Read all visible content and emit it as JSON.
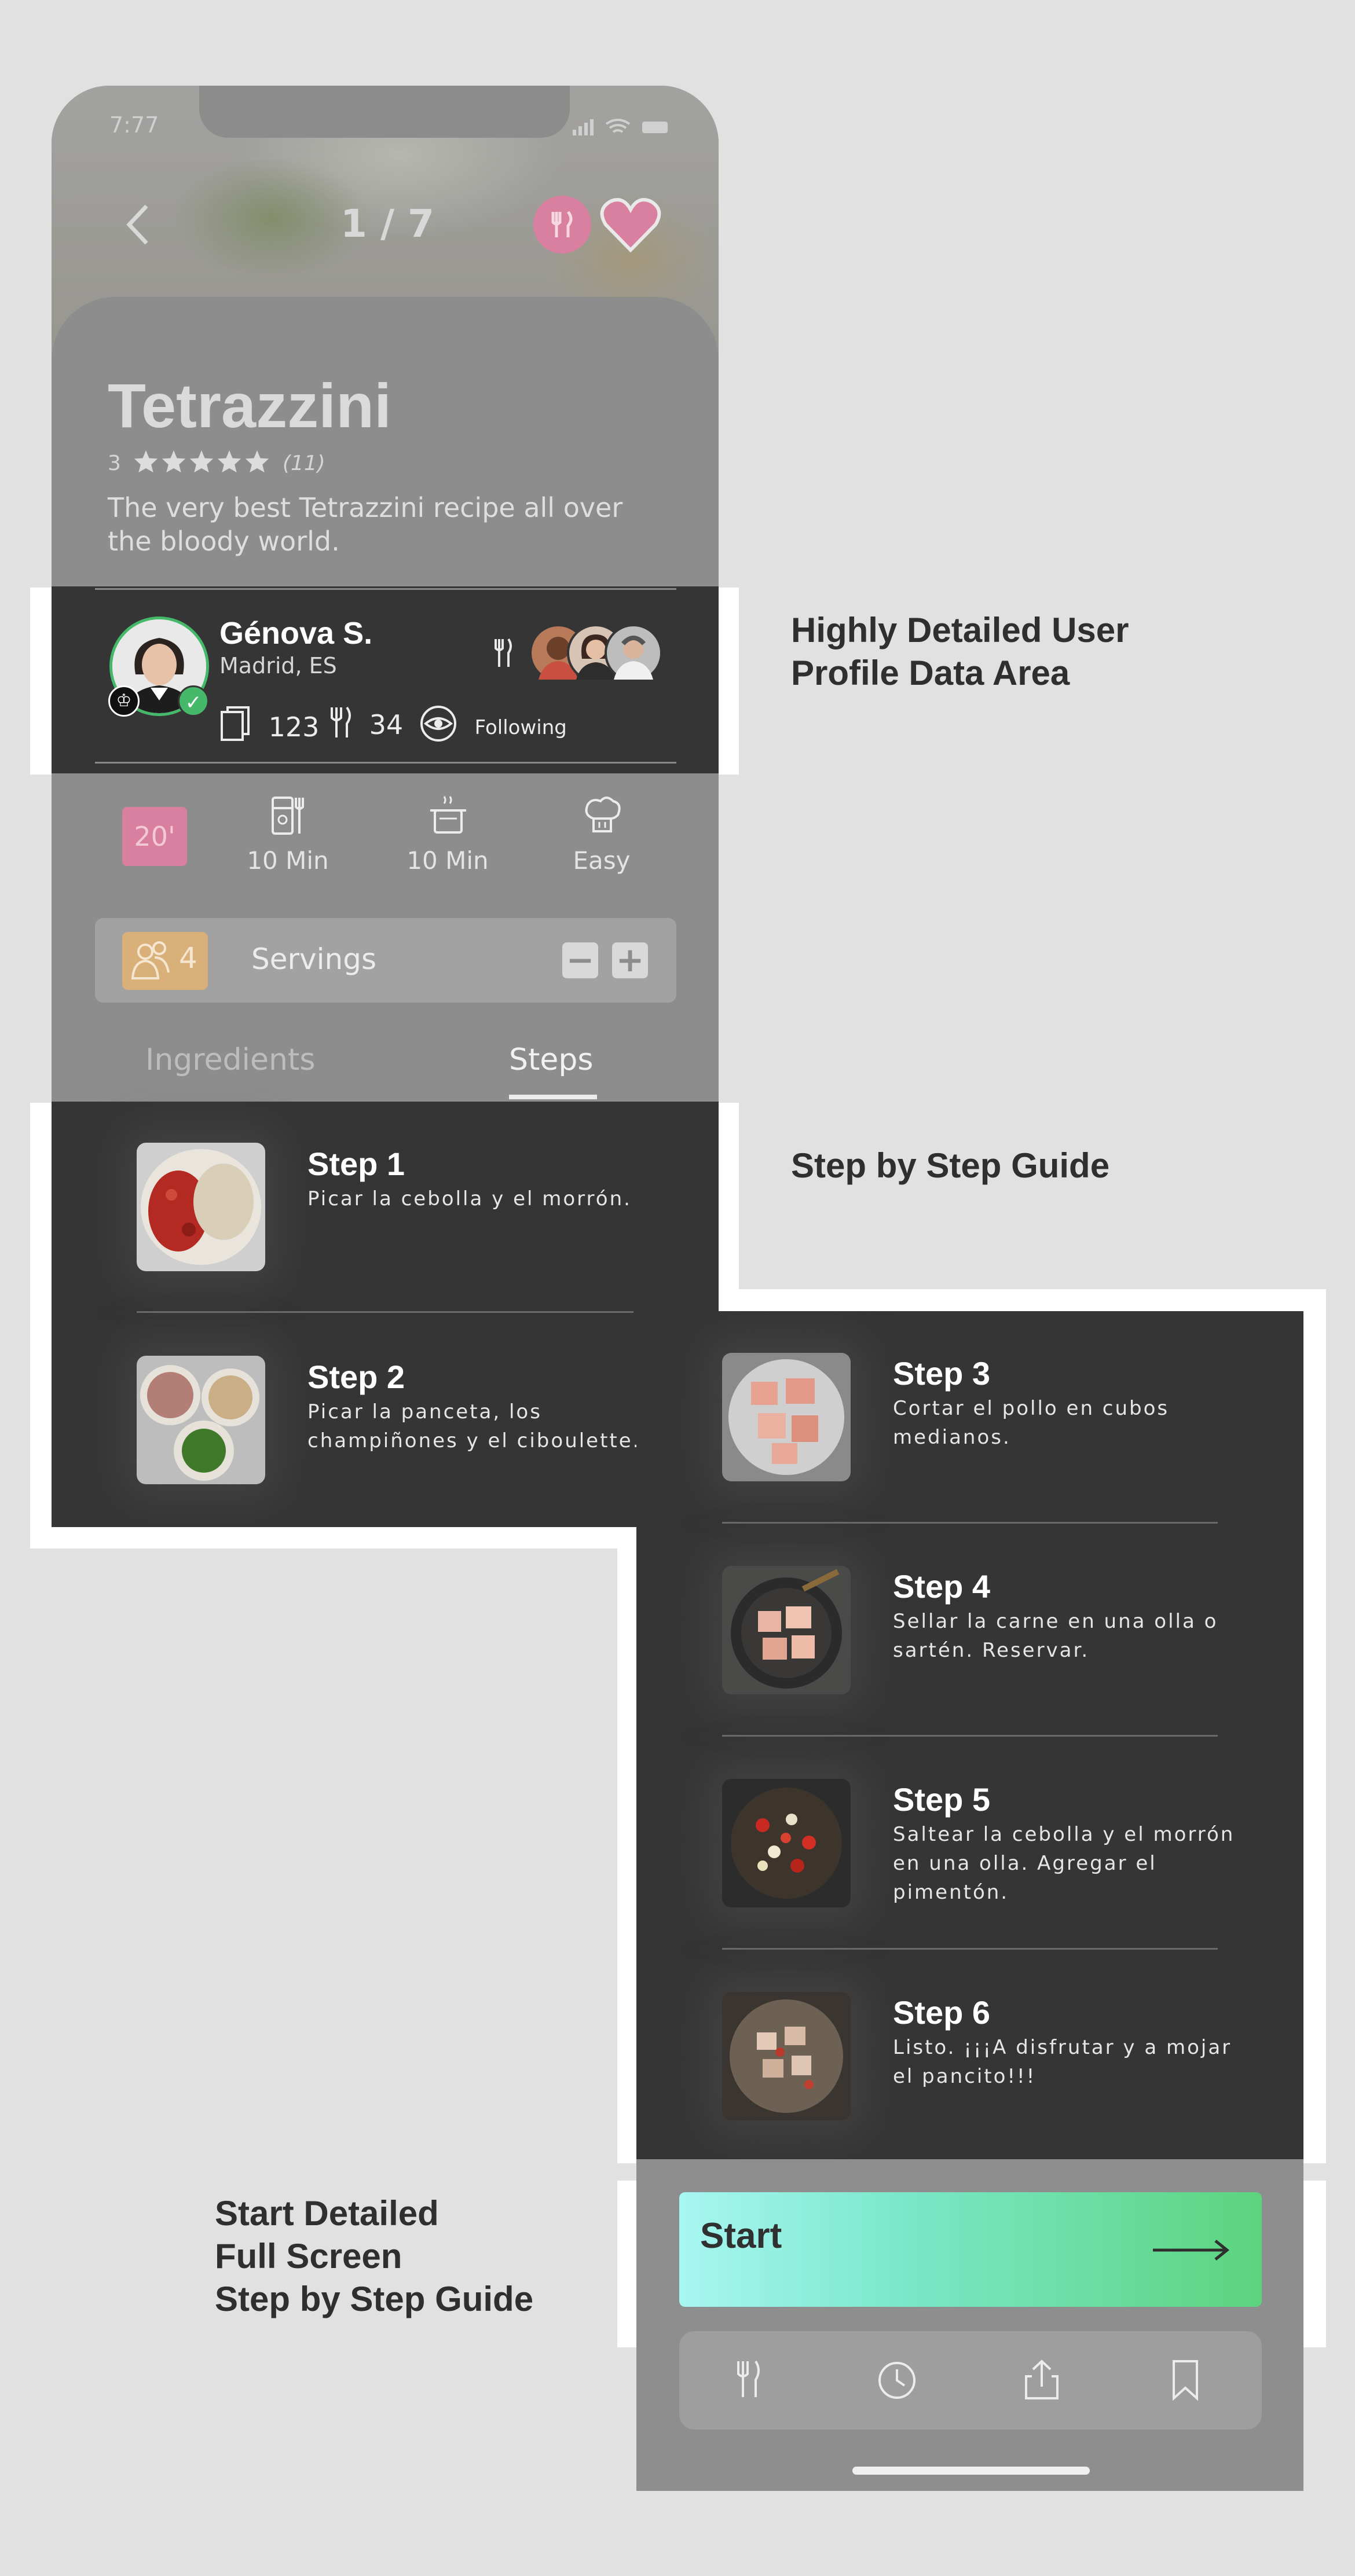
{
  "status": {
    "time": "7:77"
  },
  "header": {
    "counter": "1 / 7"
  },
  "recipe": {
    "title": "Tetrazzini",
    "rating_value": "3",
    "rating_count": "(11)",
    "stars": 5,
    "description": "The very best Tetrazzini recipe all over the bloody world."
  },
  "profile": {
    "name": "Génova S.",
    "location": "Madrid, ES",
    "recipes_count": "123",
    "cooked_count": "34",
    "follow_label": "Following"
  },
  "meta": {
    "time_badge": "20'",
    "prep_time": "10 Min",
    "cook_time": "10 Min",
    "difficulty": "Easy"
  },
  "servings": {
    "count": "4",
    "label": "Servings",
    "minus": "−",
    "plus": "+"
  },
  "tabs": {
    "ingredients": "Ingredients",
    "steps": "Steps"
  },
  "steps": [
    {
      "title": "Step 1",
      "desc": "Picar la cebolla y el morrón."
    },
    {
      "title": "Step 2",
      "desc": "Picar la panceta, los champiñones y el ciboulette."
    },
    {
      "title": "Step 3",
      "desc": "Cortar el pollo en cubos medianos."
    },
    {
      "title": "Step 4",
      "desc": "Sellar la carne en una olla o sartén. Reservar."
    },
    {
      "title": "Step 5",
      "desc": "Saltear la cebolla y el morrón en una olla. Agregar el pimentón."
    },
    {
      "title": "Step 6",
      "desc": "Listo. ¡¡¡A disfrutar y a mojar el pancito!!!"
    }
  ],
  "start": {
    "label": "Start"
  },
  "annotations": {
    "profile_line1": "Highly Detailed User",
    "profile_line2": "Profile Data Area",
    "steps": "Step by Step Guide",
    "start_line1": "Start Detailed",
    "start_line2": "Full Screen",
    "start_line3": "Step by Step Guide"
  },
  "colors": {
    "accent_pink": "#d97f9f",
    "accent_green": "#46b86a",
    "servings_tan": "#d9b07a",
    "dark_panel": "#353535"
  },
  "icons": [
    "back-arrow-icon",
    "fork-knife-icon",
    "heart-icon",
    "star-icon",
    "copy-icon",
    "eye-icon",
    "fridge-icon",
    "pot-icon",
    "chef-hat-icon",
    "people-icon",
    "arrow-right-icon",
    "clock-icon",
    "share-icon",
    "bookmark-icon",
    "trophy-icon",
    "check-icon"
  ]
}
